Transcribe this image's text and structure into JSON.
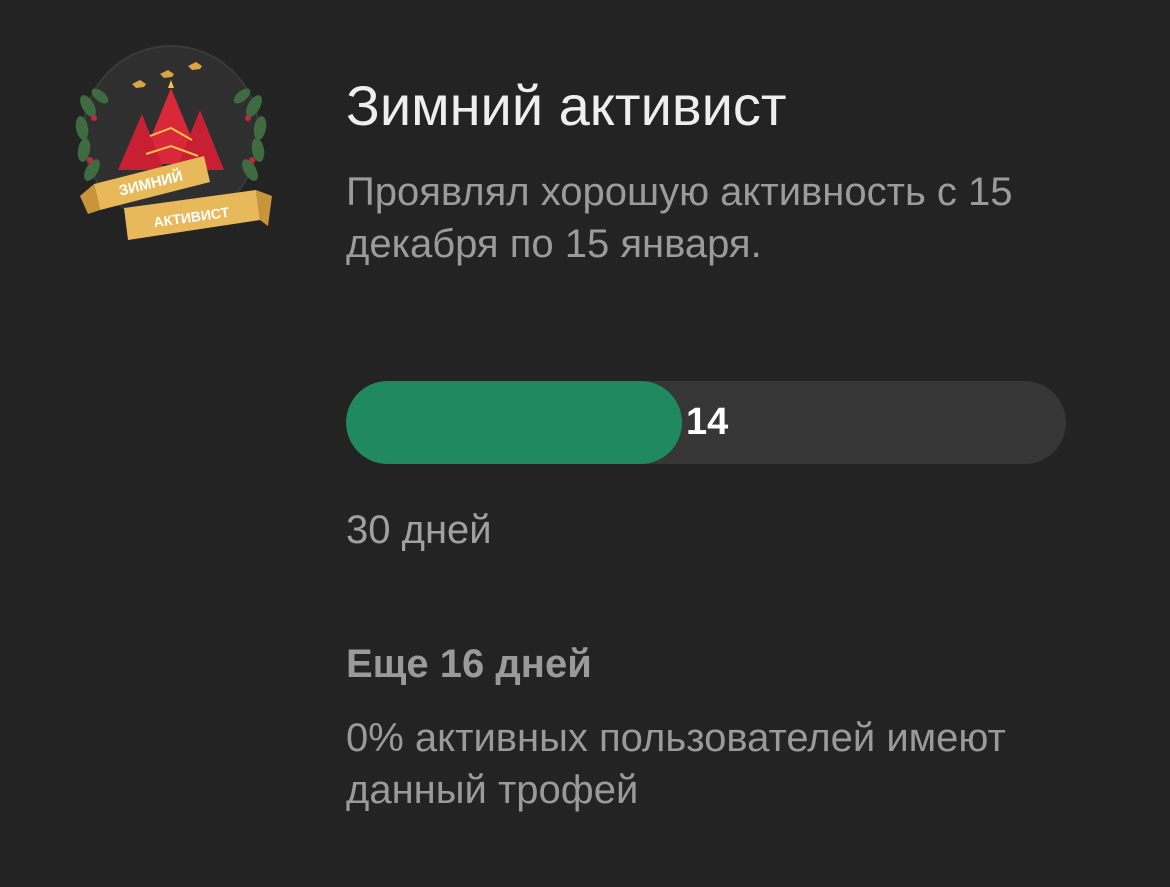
{
  "achievement": {
    "badge": {
      "icon": "winter-activist-badge-icon",
      "ribbon_line1": "ЗИМНИЙ",
      "ribbon_line2": "АКТИВИСТ"
    },
    "title": "Зимний активист",
    "description": "Проявлял хорошую активность с 15 декабря по 15 января.",
    "progress": {
      "current": 14,
      "current_label": "14",
      "total": 30,
      "fraction": 0.4667,
      "fill_color": "#20895f",
      "track_color": "#363636"
    },
    "goal_label": "30 дней",
    "remaining_label": "Еще 16 дней",
    "stat_label": "0% активных пользователей имеют данный трофей"
  }
}
